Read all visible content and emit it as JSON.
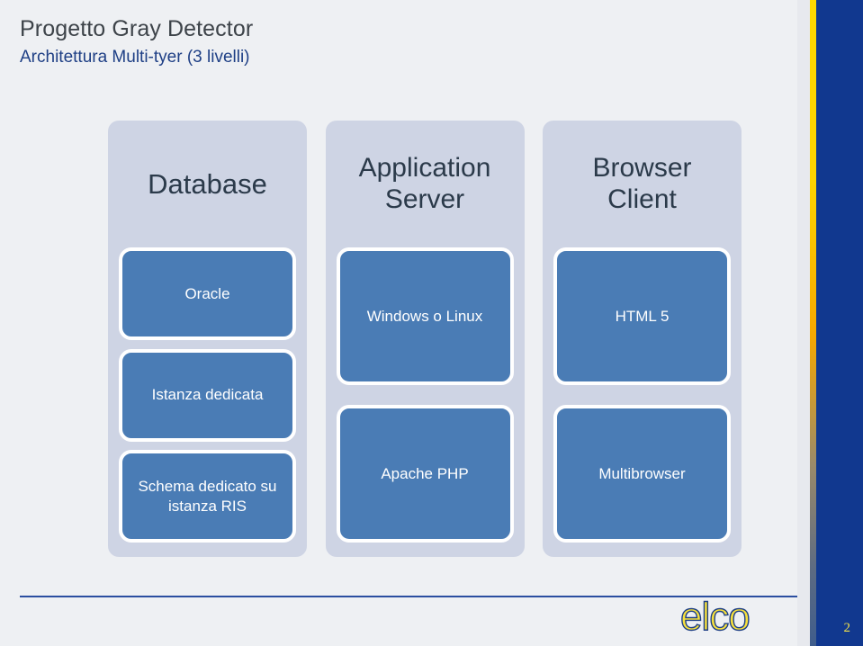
{
  "header": {
    "title": "Progetto Gray Detector",
    "subtitle": "Architettura Multi-tyer (3 livelli)"
  },
  "tiers": [
    {
      "name": "database",
      "heading": "Database",
      "boxes": [
        {
          "name": "oracle",
          "label": "Oracle"
        },
        {
          "name": "istanza-dedicata",
          "label": "Istanza dedicata"
        },
        {
          "name": "schema-dedicato",
          "label": "Schema dedicato su istanza RIS"
        }
      ]
    },
    {
      "name": "application-server",
      "heading": "Application Server",
      "boxes": [
        {
          "name": "windows-o-linux",
          "label": "Windows o Linux"
        },
        {
          "name": "apache-php",
          "label": "Apache PHP"
        }
      ]
    },
    {
      "name": "browser-client",
      "heading": "Browser Client",
      "boxes": [
        {
          "name": "html-5",
          "label": "HTML 5"
        },
        {
          "name": "multibrowser",
          "label": "Multibrowser"
        }
      ]
    }
  ],
  "footer": {
    "logo_text": "elco",
    "page_number": "2"
  },
  "colors": {
    "background": "#eef0f3",
    "title_text": "#3d4349",
    "subtitle_text": "#1e3f85",
    "tier_panel": "#ced4e4",
    "tier_heading_text": "#2b3a4a",
    "box_fill": "#4a7cb5",
    "box_border": "#ffffff",
    "box_text": "#ffffff",
    "band_blue": "#11388f",
    "stripe_yellow": "#ffd800",
    "rule_blue": "#2b4ea0",
    "logo_yellow": "#f7e03c",
    "logo_outline": "#1e3f85",
    "page_number_text": "#f2e14a"
  }
}
